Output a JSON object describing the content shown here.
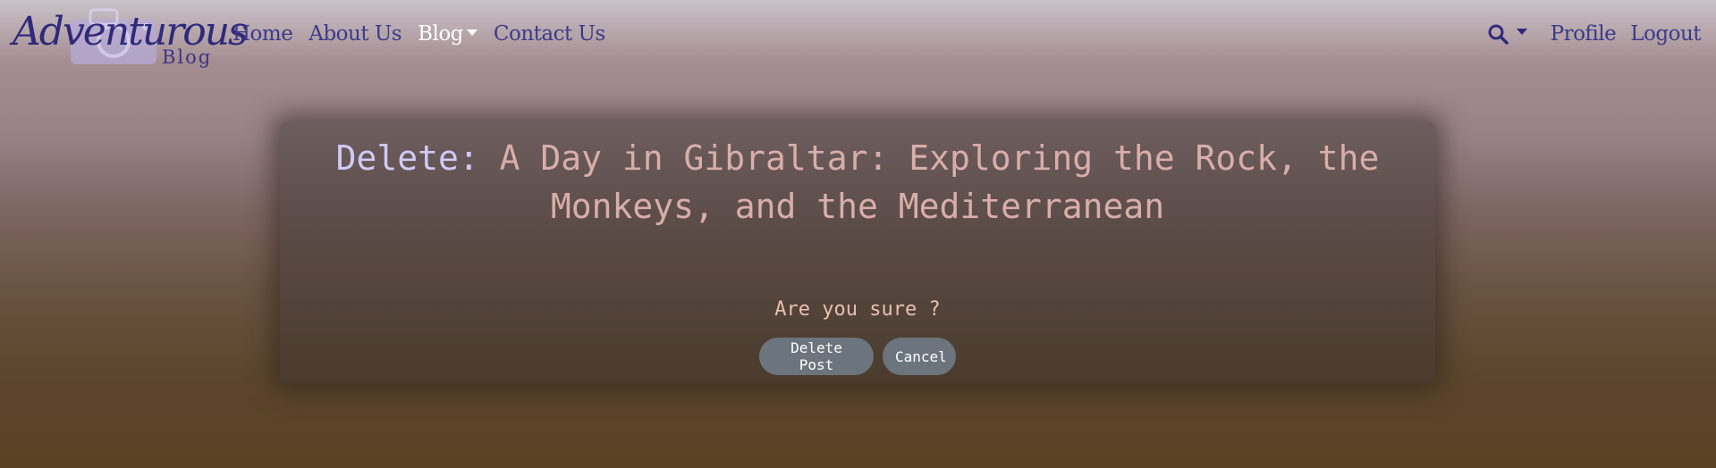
{
  "brand": {
    "script": "Adventurous",
    "sub": "Blog",
    "accent_color": "#2f2a7a"
  },
  "nav": {
    "home": "Home",
    "about": "About Us",
    "blog": "Blog",
    "contact": "Contact Us",
    "profile": "Profile",
    "logout": "Logout",
    "search_icon": "search-icon",
    "active": "Blog"
  },
  "card": {
    "title_prefix": "Delete:",
    "title": "A Day in Gibraltar: Exploring the Rock, the Monkeys, and the Mediterranean",
    "question": "Are you sure ?",
    "delete_label": "Delete Post",
    "cancel_label": "Cancel"
  },
  "colors": {
    "title_prefix": "#cfcaf5",
    "title_text": "#d8aeaa",
    "button_bg": "#6c757d",
    "nav_link": "#3c3a8a",
    "nav_active": "#ffffff"
  }
}
